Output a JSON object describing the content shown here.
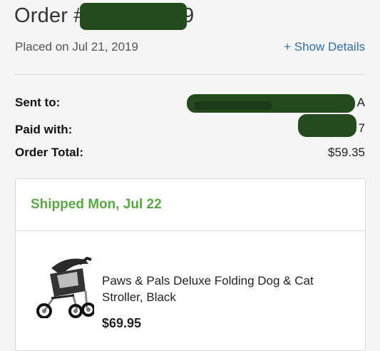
{
  "order": {
    "title": "Order #2",
    "title_suffix": "9",
    "placed": "Placed on Jul 21, 2019",
    "show_details": "+ Show Details"
  },
  "summary": {
    "sent_to_label": "Sent to:",
    "sent_to_value_tail": "A",
    "paid_with_label": "Paid with:",
    "paid_with_value_tail": "7",
    "order_total_label": "Order Total:",
    "order_total_value": "$59.35"
  },
  "shipment": {
    "status": "Shipped Mon, Jul 22",
    "status_color": "#5aa844",
    "item": {
      "name": "Paws & Pals Deluxe Folding Dog & Cat Stroller, Black",
      "price": "$69.95",
      "image": "pet-stroller-image"
    }
  },
  "colors": {
    "link": "#2d6fa6",
    "redaction": "#244a1e"
  }
}
